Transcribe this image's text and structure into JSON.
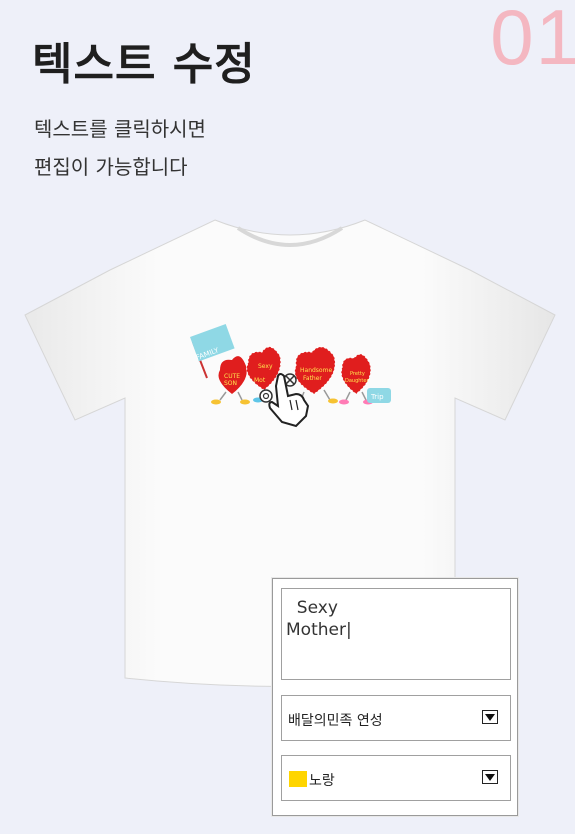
{
  "step_number": "01",
  "title": "텍스트 수정",
  "description": [
    "텍스트를 클릭하시면",
    "편집이 가능합니다"
  ],
  "design": {
    "flag_text": "FAMILY",
    "hearts": [
      {
        "text1": "CUTE",
        "text2": "SON"
      },
      {
        "text1": "Sexy",
        "text2": "Mot"
      },
      {
        "text1": "Handsome",
        "text2": "Father"
      },
      {
        "text1": "Pretty",
        "text2": "Daughter"
      }
    ],
    "suitcase_text": "Trip"
  },
  "editor": {
    "text_value": "  Sexy\nMother|",
    "font_select": "배달의민족 연성",
    "color_select": "노랑",
    "color_swatch": "#ffd500"
  }
}
